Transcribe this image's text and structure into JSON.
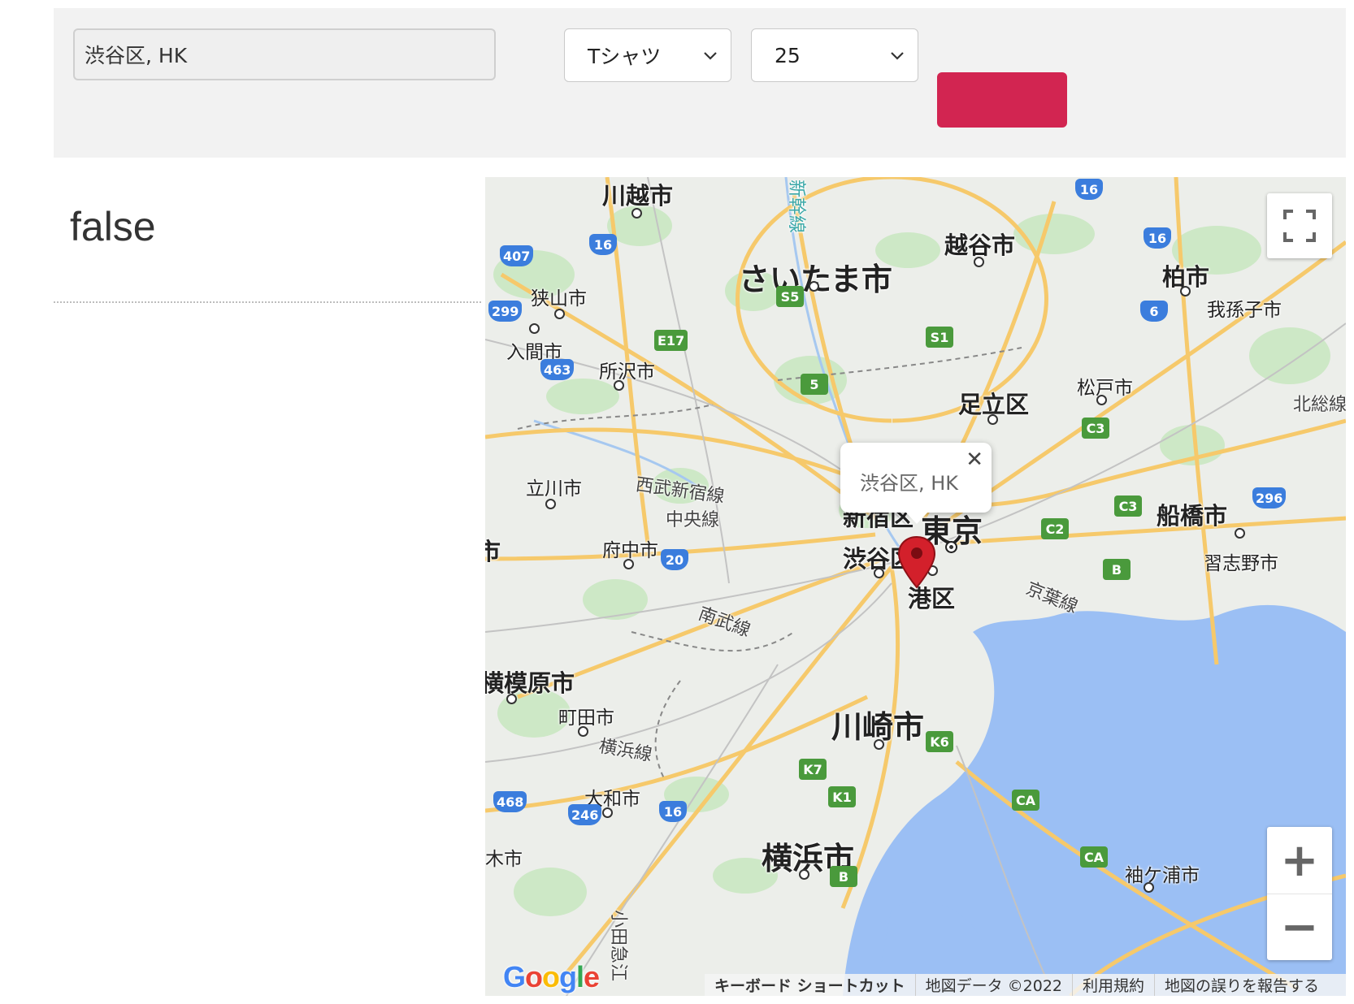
{
  "search": {
    "location_value": "渋谷区, HK",
    "kind_selected": "Tシャツ",
    "count_selected": "25",
    "submit_color": "#d22551"
  },
  "result": {
    "text": "false"
  },
  "map": {
    "popup_text": "渋谷区, HK",
    "popup_close": "✕",
    "labels": {
      "kawagoe": "川越市",
      "saitama": "さいたま市",
      "koshigaya": "越谷市",
      "kashiwa": "柏市",
      "abiko": "我孫子市",
      "sayama": "狭山市",
      "iruma": "入間市",
      "tokorozawa": "所沢市",
      "adachi": "足立区",
      "matsudo": "松戸市",
      "kitasou": "北総線",
      "seibu_shinjuku": "西武新宿線",
      "tachikawa": "立川市",
      "chuo_line": "中央線",
      "fuchu": "府中市",
      "shinjuku": "新宿区",
      "tokyo": "東京",
      "shibuya": "渋谷区",
      "minato": "港区",
      "funabashi": "船橋市",
      "narashino": "習志野市",
      "keiyo": "京葉線",
      "nambu": "南武線",
      "sagamihara": "横模原市",
      "machida": "町田市",
      "yokohama_line": "横浜線",
      "kawasaki": "川崎市",
      "yamato": "大和市",
      "yokohama": "横浜市",
      "sodegaura": "袖ケ浦市",
      "shinkansen": "新幹線",
      "odakyu": "小田急江",
      "west_edge_1": "市",
      "west_edge_2": "木市"
    },
    "shields": {
      "r407": "407",
      "r16a": "16",
      "r16b": "16",
      "r16c": "16",
      "r16d": "16",
      "r299": "299",
      "r463": "463",
      "e17": "E17",
      "s5": "S5",
      "s1": "S1",
      "r5": "5",
      "r6": "6",
      "c3a": "C3",
      "c3b": "C3",
      "c2": "C2",
      "r296": "296",
      "b1": "B",
      "b2": "B",
      "r20": "20",
      "k6": "K6",
      "k7": "K7",
      "k1": "K1",
      "ca1": "CA",
      "ca2": "CA",
      "r468": "468",
      "r246": "246"
    },
    "zoom_in": "+",
    "zoom_out": "−",
    "google_logo": "Google",
    "attribution": {
      "keyboard": "キーボード ショートカット",
      "data": "地図データ ©2022",
      "terms": "利用規約",
      "report": "地図の誤りを報告する"
    }
  }
}
